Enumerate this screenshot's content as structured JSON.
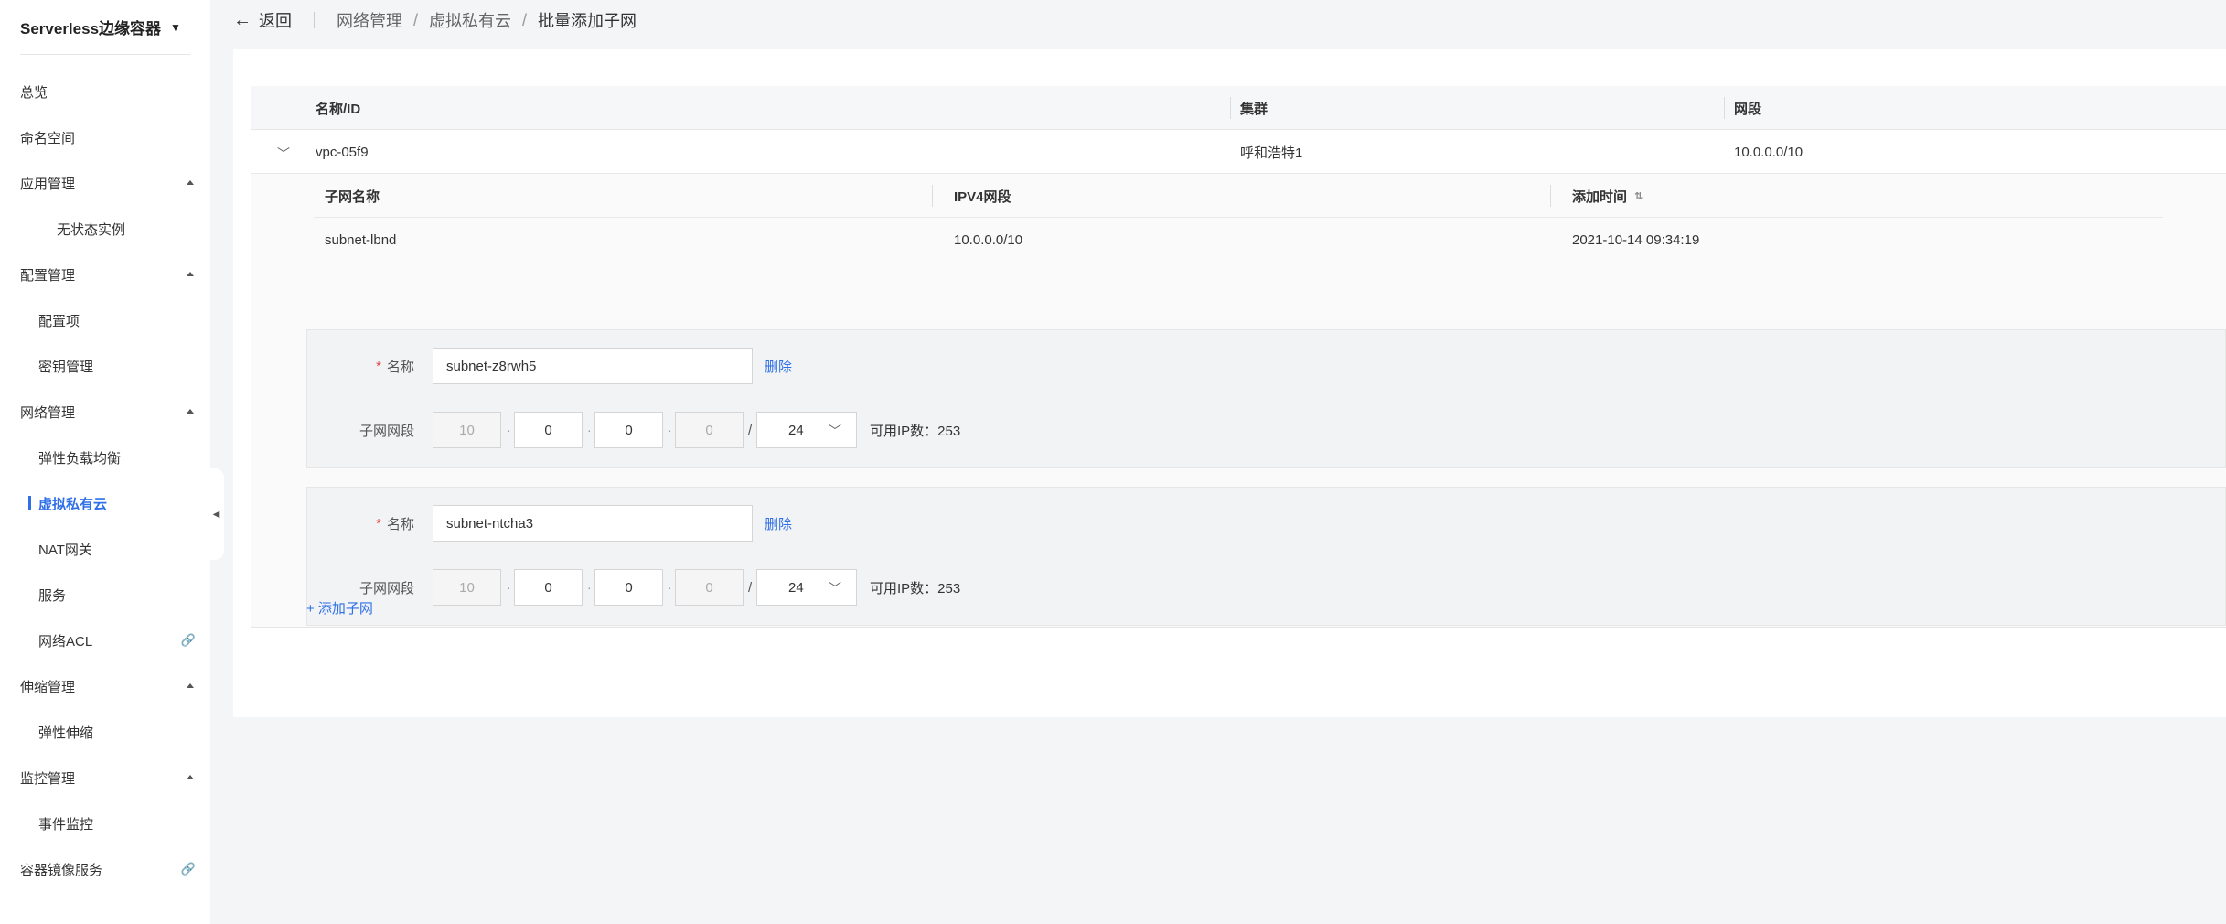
{
  "sidebar": {
    "title": "Serverless边缘容器",
    "items": [
      {
        "label": "总览",
        "level": 0
      },
      {
        "label": "命名空间",
        "level": 0
      },
      {
        "label": "应用管理",
        "level": 0,
        "expanded": true
      },
      {
        "label": "无状态实例",
        "level": 2
      },
      {
        "label": "配置管理",
        "level": 0,
        "expanded": true
      },
      {
        "label": "配置项",
        "level": 1
      },
      {
        "label": "密钥管理",
        "level": 1
      },
      {
        "label": "网络管理",
        "level": 0,
        "expanded": true
      },
      {
        "label": "弹性负载均衡",
        "level": 1
      },
      {
        "label": "虚拟私有云",
        "level": 1,
        "active": true
      },
      {
        "label": "NAT网关",
        "level": 1
      },
      {
        "label": "服务",
        "level": 1
      },
      {
        "label": "网络ACL",
        "level": 1,
        "external": true
      },
      {
        "label": "伸缩管理",
        "level": 0,
        "expanded": true
      },
      {
        "label": "弹性伸缩",
        "level": 1
      },
      {
        "label": "监控管理",
        "level": 0,
        "expanded": true
      },
      {
        "label": "事件监控",
        "level": 1
      },
      {
        "label": "容器镜像服务",
        "level": 0,
        "external": true
      }
    ]
  },
  "topbar": {
    "back_label": "返回",
    "breadcrumb": [
      "网络管理",
      "虚拟私有云",
      "批量添加子网"
    ]
  },
  "vpc_table": {
    "headers": {
      "name": "名称/ID",
      "cluster": "集群",
      "cidr": "网段"
    },
    "row": {
      "name": "vpc-05f9",
      "cluster": "呼和浩特1",
      "cidr": "10.0.0.0/10"
    }
  },
  "subnet_table": {
    "headers": {
      "name": "子网名称",
      "ipv4": "IPV4网段",
      "time": "添加时间"
    },
    "row": {
      "name": "subnet-lbnd",
      "ipv4": "10.0.0.0/10",
      "time": "2021-10-14 09:34:19"
    }
  },
  "forms": [
    {
      "name_label": "名称",
      "name_value": "subnet-z8rwh5",
      "delete_label": "删除",
      "cidr_label": "子网网段",
      "octets": [
        "10",
        "0",
        "0",
        "0"
      ],
      "mask": "24",
      "available": "可用IP数：253"
    },
    {
      "name_label": "名称",
      "name_value": "subnet-ntcha3",
      "delete_label": "删除",
      "cidr_label": "子网网段",
      "octets": [
        "10",
        "0",
        "0",
        "0"
      ],
      "mask": "24",
      "available": "可用IP数：253"
    }
  ],
  "add_subnet_label": "+ 添加子网",
  "colors": {
    "accent": "#2f6fe8",
    "required": "#e54545",
    "background": "#f4f5f7"
  }
}
